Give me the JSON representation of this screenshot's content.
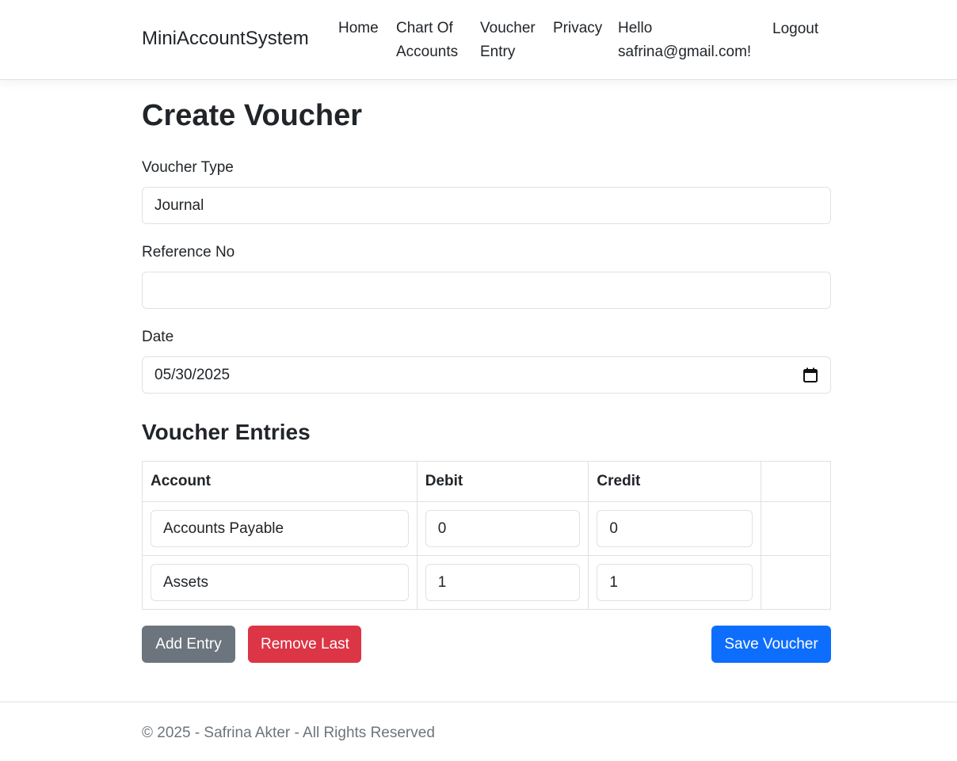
{
  "navbar": {
    "brand": "MiniAccountSystem",
    "links": [
      {
        "line1": "Home",
        "line2": ""
      },
      {
        "line1": "Chart Of",
        "line2": "Accounts"
      },
      {
        "line1": "Voucher",
        "line2": "Entry"
      },
      {
        "line1": "Privacy",
        "line2": ""
      }
    ],
    "greeting": {
      "line1": "Hello",
      "line2": "safrina@gmail.com!"
    },
    "logout": "Logout"
  },
  "page": {
    "title": "Create Voucher"
  },
  "form": {
    "voucher_type": {
      "label": "Voucher Type",
      "value": "Journal"
    },
    "reference_no": {
      "label": "Reference No",
      "value": ""
    },
    "date": {
      "label": "Date",
      "value": "05/30/2025",
      "icon": "calendar-icon"
    }
  },
  "entries": {
    "title": "Voucher Entries",
    "columns": [
      "Account",
      "Debit",
      "Credit",
      ""
    ],
    "rows": [
      {
        "account": "Accounts Payable",
        "debit": "0",
        "credit": "0"
      },
      {
        "account": "Assets",
        "debit": "1",
        "credit": "1"
      }
    ]
  },
  "buttons": {
    "add_entry": "Add Entry",
    "remove_last": "Remove Last",
    "save_voucher": "Save Voucher"
  },
  "colors": {
    "secondary": "#6c757d",
    "danger": "#dc3545",
    "primary": "#0d6efd",
    "border": "#dee2e6"
  },
  "footer": {
    "text": "© 2025 - Safrina Akter - All Rights Reserved"
  }
}
